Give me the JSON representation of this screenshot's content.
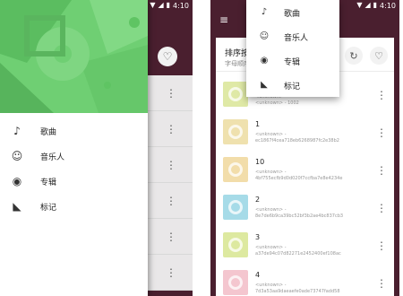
{
  "status_bar": {
    "time": "4:10"
  },
  "colors": {
    "primary": "#4a1f2f",
    "drawer_header": "#6fcf73",
    "list_bg": "#ffffff"
  },
  "drawer": {
    "items": [
      {
        "label": "歌曲",
        "icon": "music-note-icon"
      },
      {
        "label": "音乐人",
        "icon": "person-icon"
      },
      {
        "label": "专辑",
        "icon": "album-icon"
      },
      {
        "label": "标记",
        "icon": "tag-icon"
      }
    ]
  },
  "popup_menu": {
    "items": [
      {
        "label": "歌曲",
        "icon": "music-note-icon"
      },
      {
        "label": "音乐人",
        "icon": "person-icon"
      },
      {
        "label": "专辑",
        "icon": "album-icon"
      },
      {
        "label": "标记",
        "icon": "tag-icon"
      }
    ]
  },
  "sort_bar": {
    "title": "排序按",
    "subtitle": "字母顺序"
  },
  "tracks": [
    {
      "name": "",
      "artist": "<unknown>",
      "file": "<unknown> - 1002",
      "thumb_color": "#dfe9a6"
    },
    {
      "name": "1",
      "artist": "<unknown> -",
      "file": "ec1867f4cea718eb6268987fc2e38b2",
      "thumb_color": "#efe1ae"
    },
    {
      "name": "10",
      "artist": "<unknown> -",
      "file": "4bf755ecfb9d0d020f7ccfba7e8e4234e",
      "thumb_color": "#f2ddaa"
    },
    {
      "name": "2",
      "artist": "<unknown> -",
      "file": "8e7de6b9ca39bc52bf3b2ae4bc837cb3",
      "thumb_color": "#a6dbe8"
    },
    {
      "name": "3",
      "artist": "<unknown> -",
      "file": "a37de94c07d82271e2452400ef108ac",
      "thumb_color": "#dde9a0"
    },
    {
      "name": "4",
      "artist": "<unknown> -",
      "file": "7d3a53aa9daeaefe0ade73747fadd58",
      "thumb_color": "#f4c6cf"
    }
  ]
}
